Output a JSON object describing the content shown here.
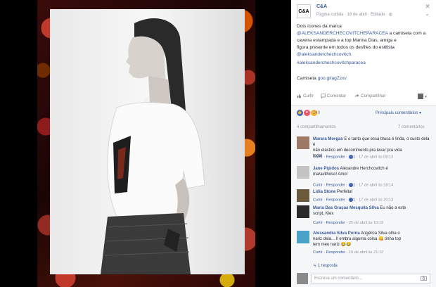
{
  "post": {
    "page_name": "C&A",
    "page_avatar_text": "C&A",
    "meta": "Página curtida · 16 de abril · Editado · ",
    "body": {
      "line1": "Dois ícones da marca",
      "line2_link": "@ALEKSANDERCHECOVITCHEPARACEA",
      "line2_rest": " a camiseta com a",
      "line3": "caveira estampada e a top Marina Dias, amiga e",
      "line4": "figura presente em todos os desfiles do estilista",
      "line5": "@aleksanderchechcovitch.",
      "line6": "#aleksanderchechcovitchparacea",
      "line7_prefix": "Camiseta ",
      "line7_link": "goo.gl/agZzxv"
    },
    "actions": {
      "like": "Curtir",
      "comment": "Comentar",
      "share": "Compartilhar"
    },
    "reaction_count": "249",
    "relevant_comments": "Principais comentários ▾",
    "shares": "4 compartilhamentos",
    "comment_count": "7 comentários"
  },
  "comments": [
    {
      "name": "Marara Morgas",
      "text": " E o tanto que essa blusa é linda, o custo dela é ",
      "text2": "não elástico em decorrimento pra levar pra vida",
      "text3": "toda!",
      "meta_actions": "Curtir · Responder · ",
      "meta_likes": "1",
      "meta_time": " · 17 de abril às 08:13",
      "avatar_color": "#9c7a66"
    },
    {
      "name": "Jane Pipidos",
      "text": " Alexandre Herchcovitch é",
      "text2": "maravilhoso! Amo!",
      "text3": "",
      "meta_actions": "Curtir · Responder · ",
      "meta_likes": "1",
      "meta_time": " · 17 de abril às 18:14",
      "avatar_color": "#c4c4c4"
    },
    {
      "name": "Lidia Stone",
      "text": " Perfeita!",
      "text2": "",
      "text3": "",
      "meta_actions": "Curtir · Responder · ",
      "meta_likes": "1",
      "meta_time": " · 17 de abril às 20:13",
      "avatar_color": "#6b5a3c"
    },
    {
      "name": "Maria Das Graças Mesquita Silva",
      "text": " Eu não a este",
      "text2": "script, Klex",
      "text3": "",
      "meta_actions": "Curtir · Responder · ",
      "meta_likes": "",
      "meta_time": "25 de abril às 10:19",
      "avatar_color": "#2b2b2b"
    },
    {
      "name": "Alessandra Silva Porna",
      "text": " Angélica Silva olha o",
      "text2": "nariz dela... Il embra alguma coisa 😋 tinha top",
      "text3": "tem meu nariz 😂😂",
      "meta_actions": "Curtir · Responder · ",
      "meta_likes": "",
      "meta_time": "16 de abril às 21:12",
      "avatar_color": "#4aa3c8"
    }
  ],
  "reply_link": "↳ 1 resposta",
  "write_placeholder": "Escreva um comentário...",
  "colors": {
    "link": "#365899",
    "muted": "#90949c",
    "like_blue": "#4267b2",
    "heart_red": "#f25268"
  },
  "icons": [
    "close-icon",
    "more-icon",
    "like-icon",
    "comment-icon",
    "share-icon",
    "camera-icon"
  ]
}
